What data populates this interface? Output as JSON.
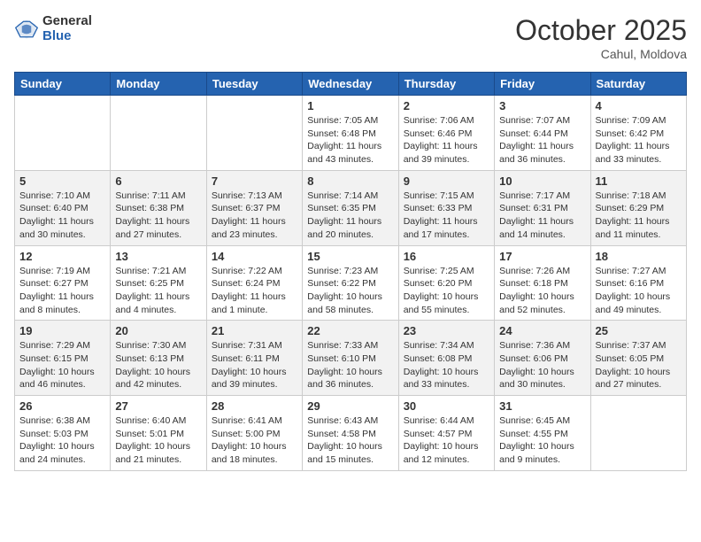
{
  "header": {
    "logo_general": "General",
    "logo_blue": "Blue",
    "month": "October 2025",
    "location": "Cahul, Moldova"
  },
  "weekdays": [
    "Sunday",
    "Monday",
    "Tuesday",
    "Wednesday",
    "Thursday",
    "Friday",
    "Saturday"
  ],
  "weeks": [
    [
      {
        "day": "",
        "info": ""
      },
      {
        "day": "",
        "info": ""
      },
      {
        "day": "",
        "info": ""
      },
      {
        "day": "1",
        "info": "Sunrise: 7:05 AM\nSunset: 6:48 PM\nDaylight: 11 hours\nand 43 minutes."
      },
      {
        "day": "2",
        "info": "Sunrise: 7:06 AM\nSunset: 6:46 PM\nDaylight: 11 hours\nand 39 minutes."
      },
      {
        "day": "3",
        "info": "Sunrise: 7:07 AM\nSunset: 6:44 PM\nDaylight: 11 hours\nand 36 minutes."
      },
      {
        "day": "4",
        "info": "Sunrise: 7:09 AM\nSunset: 6:42 PM\nDaylight: 11 hours\nand 33 minutes."
      }
    ],
    [
      {
        "day": "5",
        "info": "Sunrise: 7:10 AM\nSunset: 6:40 PM\nDaylight: 11 hours\nand 30 minutes."
      },
      {
        "day": "6",
        "info": "Sunrise: 7:11 AM\nSunset: 6:38 PM\nDaylight: 11 hours\nand 27 minutes."
      },
      {
        "day": "7",
        "info": "Sunrise: 7:13 AM\nSunset: 6:37 PM\nDaylight: 11 hours\nand 23 minutes."
      },
      {
        "day": "8",
        "info": "Sunrise: 7:14 AM\nSunset: 6:35 PM\nDaylight: 11 hours\nand 20 minutes."
      },
      {
        "day": "9",
        "info": "Sunrise: 7:15 AM\nSunset: 6:33 PM\nDaylight: 11 hours\nand 17 minutes."
      },
      {
        "day": "10",
        "info": "Sunrise: 7:17 AM\nSunset: 6:31 PM\nDaylight: 11 hours\nand 14 minutes."
      },
      {
        "day": "11",
        "info": "Sunrise: 7:18 AM\nSunset: 6:29 PM\nDaylight: 11 hours\nand 11 minutes."
      }
    ],
    [
      {
        "day": "12",
        "info": "Sunrise: 7:19 AM\nSunset: 6:27 PM\nDaylight: 11 hours\nand 8 minutes."
      },
      {
        "day": "13",
        "info": "Sunrise: 7:21 AM\nSunset: 6:25 PM\nDaylight: 11 hours\nand 4 minutes."
      },
      {
        "day": "14",
        "info": "Sunrise: 7:22 AM\nSunset: 6:24 PM\nDaylight: 11 hours\nand 1 minute."
      },
      {
        "day": "15",
        "info": "Sunrise: 7:23 AM\nSunset: 6:22 PM\nDaylight: 10 hours\nand 58 minutes."
      },
      {
        "day": "16",
        "info": "Sunrise: 7:25 AM\nSunset: 6:20 PM\nDaylight: 10 hours\nand 55 minutes."
      },
      {
        "day": "17",
        "info": "Sunrise: 7:26 AM\nSunset: 6:18 PM\nDaylight: 10 hours\nand 52 minutes."
      },
      {
        "day": "18",
        "info": "Sunrise: 7:27 AM\nSunset: 6:16 PM\nDaylight: 10 hours\nand 49 minutes."
      }
    ],
    [
      {
        "day": "19",
        "info": "Sunrise: 7:29 AM\nSunset: 6:15 PM\nDaylight: 10 hours\nand 46 minutes."
      },
      {
        "day": "20",
        "info": "Sunrise: 7:30 AM\nSunset: 6:13 PM\nDaylight: 10 hours\nand 42 minutes."
      },
      {
        "day": "21",
        "info": "Sunrise: 7:31 AM\nSunset: 6:11 PM\nDaylight: 10 hours\nand 39 minutes."
      },
      {
        "day": "22",
        "info": "Sunrise: 7:33 AM\nSunset: 6:10 PM\nDaylight: 10 hours\nand 36 minutes."
      },
      {
        "day": "23",
        "info": "Sunrise: 7:34 AM\nSunset: 6:08 PM\nDaylight: 10 hours\nand 33 minutes."
      },
      {
        "day": "24",
        "info": "Sunrise: 7:36 AM\nSunset: 6:06 PM\nDaylight: 10 hours\nand 30 minutes."
      },
      {
        "day": "25",
        "info": "Sunrise: 7:37 AM\nSunset: 6:05 PM\nDaylight: 10 hours\nand 27 minutes."
      }
    ],
    [
      {
        "day": "26",
        "info": "Sunrise: 6:38 AM\nSunset: 5:03 PM\nDaylight: 10 hours\nand 24 minutes."
      },
      {
        "day": "27",
        "info": "Sunrise: 6:40 AM\nSunset: 5:01 PM\nDaylight: 10 hours\nand 21 minutes."
      },
      {
        "day": "28",
        "info": "Sunrise: 6:41 AM\nSunset: 5:00 PM\nDaylight: 10 hours\nand 18 minutes."
      },
      {
        "day": "29",
        "info": "Sunrise: 6:43 AM\nSunset: 4:58 PM\nDaylight: 10 hours\nand 15 minutes."
      },
      {
        "day": "30",
        "info": "Sunrise: 6:44 AM\nSunset: 4:57 PM\nDaylight: 10 hours\nand 12 minutes."
      },
      {
        "day": "31",
        "info": "Sunrise: 6:45 AM\nSunset: 4:55 PM\nDaylight: 10 hours\nand 9 minutes."
      },
      {
        "day": "",
        "info": ""
      }
    ]
  ]
}
